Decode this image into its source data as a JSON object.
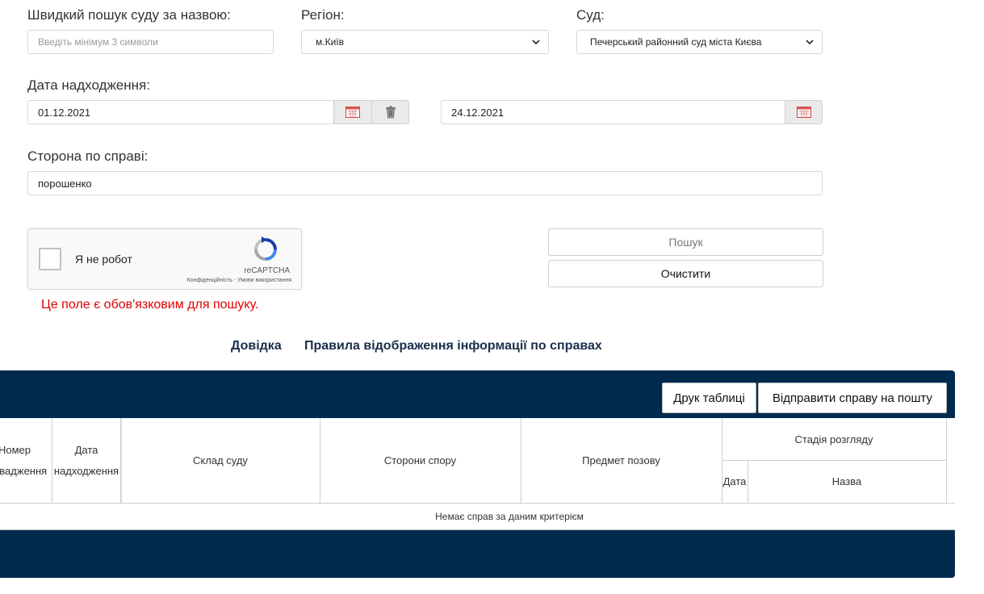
{
  "search": {
    "court_name_label": "Швидкий пошук суду за назвою:",
    "court_name_placeholder": "Введіть мінімум 3 символи",
    "region_label": "Регіон:",
    "region_value": "м.Київ",
    "court_label": "Суд:",
    "court_value": "Печерський районний суд міста Києва",
    "date_label": "Дата надходження:",
    "date_from": "01.12.2021",
    "date_to": "24.12.2021",
    "party_label": "Сторона по справі:",
    "party_value": "порошенко"
  },
  "captcha": {
    "label": "Я не робот",
    "brand": "reCAPTCHA",
    "links": "Конфіденційність - Умови використання",
    "error": "Це поле є обов'язковим для пошуку."
  },
  "actions": {
    "search_label": "Пошук",
    "clear_label": "Очистити"
  },
  "links": {
    "help": "Довідка",
    "rules": "Правила відображення інформації по справах"
  },
  "table": {
    "print_label": "Друк таблиці",
    "send_label": "Відправити справу на пошту",
    "headers": {
      "number": "Номер провадження",
      "date": "Дата надходження",
      "composition": "Склад суду",
      "parties": "Сторони спору",
      "subject": "Предмет позову",
      "stage": "Стадія розгляду",
      "stage_date": "Дата",
      "stage_name": "Назва"
    },
    "empty_message": "Немає справ за даним критерієм"
  },
  "colors": {
    "panel": "#012a4f",
    "error": "#e00000",
    "link": "#1b2f4a"
  },
  "icons": [
    "chevron-down-icon",
    "calendar-icon",
    "trash-icon",
    "recaptcha-logo-icon"
  ]
}
